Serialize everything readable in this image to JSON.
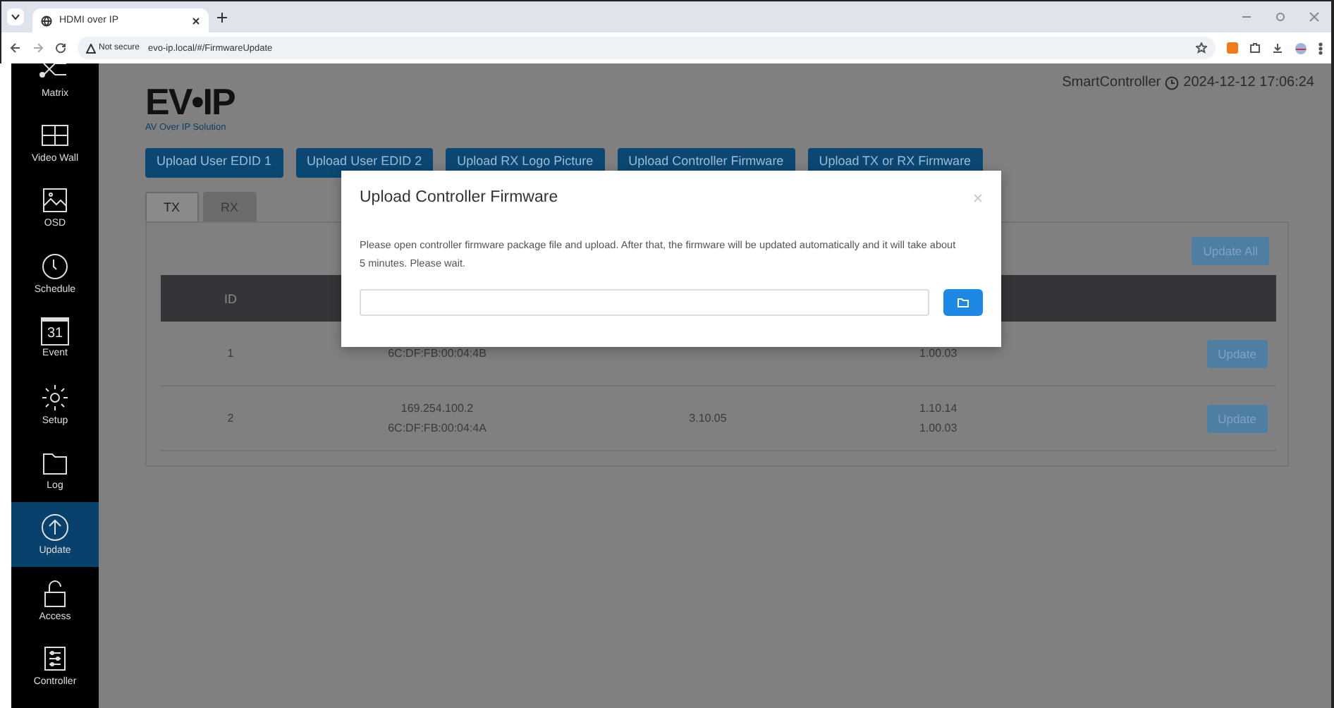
{
  "browser": {
    "tabs": [
      {
        "title": "HDMI over IP",
        "selected": true
      }
    ],
    "address": {
      "security": "Not secure",
      "url": "evo-ip.local/#/FirmwareUpdate"
    }
  },
  "sidebar": {
    "items": [
      {
        "label": "Matrix",
        "selected": false
      },
      {
        "label": "Video Wall",
        "selected": false
      },
      {
        "label": "OSD",
        "selected": false
      },
      {
        "label": "Schedule",
        "selected": false
      },
      {
        "label": "Event",
        "selected": false
      },
      {
        "label": "Setup",
        "selected": false
      },
      {
        "label": "Log",
        "selected": false
      },
      {
        "label": "Update",
        "selected": true
      },
      {
        "label": "Access",
        "selected": false
      },
      {
        "label": "Controller",
        "selected": false
      }
    ]
  },
  "header": {
    "logo": "EV•IP",
    "tagline": "AV Over IP Solution",
    "controller": "SmartController",
    "datetime": "2024-12-12 17:06:24"
  },
  "calendar_day": "31",
  "actions": [
    "Upload User EDID 1",
    "Upload User EDID 2",
    "Upload RX Logo Picture",
    "Upload Controller Firmware",
    "Upload TX or RX Firmware"
  ],
  "tabs": [
    {
      "label": "TX",
      "selected": true
    },
    {
      "label": "RX",
      "selected": false
    }
  ],
  "update_all": "Update All",
  "table": {
    "columns": [
      "ID"
    ],
    "rows": [
      {
        "cells": [
          [
            "1"
          ],
          [
            "6C:DF:FB:00:04:4B"
          ],
          [],
          [
            "1.00.03"
          ]
        ],
        "action": "Update"
      },
      {
        "cells": [
          [
            "2"
          ],
          [
            "169.254.100.2",
            "6C:DF:FB:00:04:4A"
          ],
          [
            "3.10.05"
          ],
          [
            "1.10.14",
            "1.00.03"
          ]
        ],
        "action": "Update"
      }
    ]
  },
  "modal": {
    "title": "Upload Controller Firmware",
    "message": "Please open controller firmware package file and upload. After that, the firmware will be updated automatically and it will take about 5 minutes. Please wait."
  }
}
